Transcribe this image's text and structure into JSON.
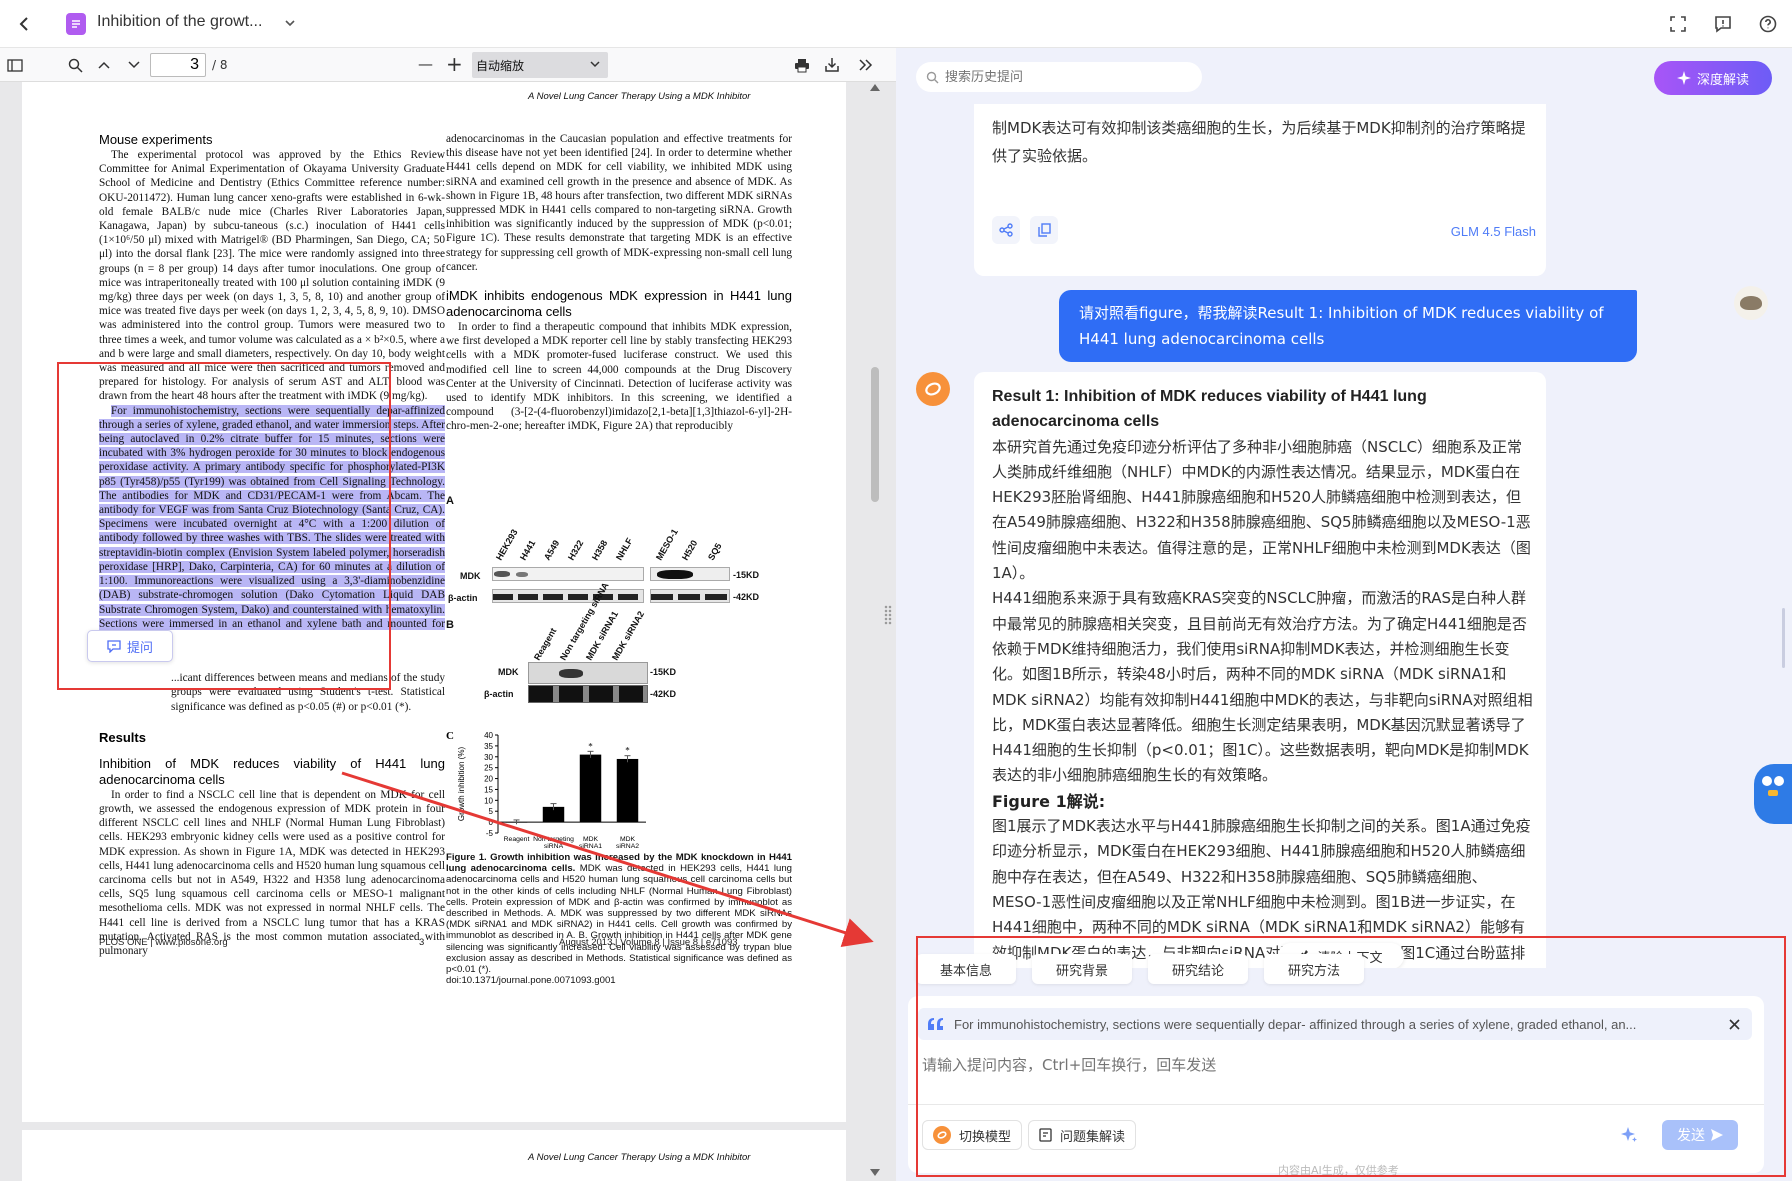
{
  "topbar": {
    "title": "Inhibition of the growt...",
    "back_icon": "chevron-left-icon",
    "doc_icon": "document-icon",
    "brand_color": "#8b5cf6"
  },
  "pdf_toolbar": {
    "page": "3",
    "page_total": "/ 8",
    "zoom": "自动缩放",
    "zoom_minus": "—",
    "zoom_plus": "+"
  },
  "pdf": {
    "running_header": "A Novel Lung Cancer Therapy Using a MDK Inhibitor",
    "footer_left": "PLOS ONE | www.plosone.org",
    "footer_center": "3",
    "footer_right": "August 2013 | Volume 8 | Issue 8 | e71093",
    "left": {
      "h_mouse": "Mouse experiments",
      "p_mouse": "The experimental protocol was approved by the Ethics Review Committee for Animal Experimentation of Okayama University Graduate School of Medicine and Dentistry (Ethics Committee reference number: OKU-2011472). Human lung cancer xeno-grafts were established in 6-wk-old female BALB/c nude mice (Charles River Laboratories Japan, Kanagawa, Japan) by subcu-taneous (s.c.) inoculation of H441 cells (1×10⁶/50 μl) mixed with Matrigel® (BD Pharmingen, San Diego, CA; 50 μl) into the dorsal flank [23]. The mice were randomly assigned into three groups (n = 8 per group) 14 days after tumor inoculations. One group of mice was intraperitoneally treated with 100 μl solution containing iMDK (9 mg/kg) three days per week (on days 1, 3, 5, 8, 10) and another group of mice was treated five days per week (on days 1, 2, 3, 4, 5, 8, 9, 10). DMSO was administered into the control group. Tumors were measured two to three times a week, and tumor volume was calculated as a × b²×0.5, where a and b were large and small diameters, respectively. On day 10, body weight was measured and all mice were then sacrificed and tumors removed and prepared for histology. For analysis of serum AST and ALT, blood was drawn from the heart 48 hours after the treatment with iMDK (9 mg/kg).",
      "p_ihc": "For immunohistochemistry, sections were sequentially depar-affinized through a series of xylene, graded ethanol, and water immersion steps. After being autoclaved in 0.2% citrate buffer for 15 minutes, sections were incubated with 3% hydrogen peroxide for 30 minutes to block endogenous peroxidase activity. A primary antibody specific for phosphorylated-PI3K p85 (Tyr458)/p55 (Tyr199) was obtained from Cell Signaling Technology. The antibodies for MDK and CD31/PECAM-1 were from Abcam. The antibody for VEGF was from Santa Cruz Biotechnology (Santa Cruz, CA). Specimens were incubated overnight at 4°C with a 1:200 dilution of antibody followed by three washes with TBS. The slides were treated with streptavidin-biotin complex (Envision System labeled polymer, horseradish peroxidase [HRP], Dako, Carpinteria, CA) for 60 minutes at a dilution of 1:100. Immunoreactions were visualized using a 3,3'-diaminobenzidine (DAB) substrate-chromogen solution (Dako Cytomation Liquid DAB Substrate Chromogen System, Dako) and counterstained with hematoxylin. Sections were immersed in an ethanol and xylene bath and mounted for examination.",
      "p_stat": "...icant differences between means and medians of the study groups were evaluated using Student's t-test. Statistical significance was defined as p<0.05 (#) or p<0.01 (*).",
      "h_results": "Results",
      "h_inhib": "Inhibition of MDK reduces viability of H441 lung adenocarcinoma cells",
      "p_inhib": "In order to find a NSCLC cell line that is dependent on MDK for cell growth, we assessed the endogenous expression of MDK protein in four different NSCLC cell lines and NHLF (Normal Human Lung Fibroblast) cells. HEK293 embryonic kidney cells were used as a positive control for MDK expression. As shown in Figure 1A, MDK was detected in HEK293 cells, H441 lung adenocarcinoma cells and H520 human lung squamous cell carcinoma cells but not in A549, H322 and H358 lung adenocarcinoma cells, SQ5 lung squamous cell carcinoma cells or MESO-1 malignant mesothelioma cells. MDK was not expressed in normal NHLF cells. The H441 cell line is derived from a NSCLC lung tumor that has a KRAS mutation. Activated RAS is the most common mutation associated with pulmonary"
    },
    "right": {
      "p_top": "adenocarcinomas in the Caucasian population and effective treatments for this disease have not yet been identified [24]. In order to determine whether H441 cells depend on MDK for cell viability, we inhibited MDK using siRNA and examined cell growth in the presence and absence of MDK. As shown in Figure 1B, 48 hours after transfection, two different MDK siRNAs suppressed MDK in H441 cells compared to non-targeting siRNA. Growth inhibition was significantly induced by the suppression of MDK (p<0.01; Figure 1C). These results demonstrate that targeting MDK is an effective strategy for suppressing cell growth of MDK-expressing non-small cell lung cancer.",
      "h_imdk": "iMDK inhibits endogenous MDK expression in H441 lung adenocarcinoma cells",
      "p_imdk": "In order to find a therapeutic compound that inhibits MDK expression, we first developed a MDK reporter cell line by stably transfecting HEK293 cells with a MDK promoter-fused luciferase construct. We used this modified cell line to screen 44,000 compounds at the Drug Discovery Center at the University of Cincinnati. Detection of luciferase activity was used to identify MDK inhibitors. In this screening, we identified a compound (3-[2-(4-fluorobenzyl)imidazo[2,1-beta][1,3]thiazol-6-yl]-2H-chro-men-2-one; hereafter iMDK, Figure 2A) that reproducibly",
      "caption_bold": "Figure 1. Growth inhibition was increased by the MDK knockdown in H441 lung adenocarcinoma cells.",
      "caption": " MDK was detected in HEK293 cells, H441 lung adenocarcinoma cells and H520 human lung squamous cell carcinoma cells but not in the other kinds of cells including NHLF (Normal Human Lung Fibroblast) cells. Protein expression of MDK and β-actin was confirmed by immunoblot as described in Methods. A. MDK was suppressed by two different MDK siRNAs (MDK siRNA1 and MDK siRNA2) in H441 cells. Cell growth was confirmed by immunoblot as described in A. B. Growth inhibition in H441 cells after MDK gene silencing was significantly increased. Cell viability was assessed by trypan blue exclusion assay as described in Methods. Statistical significance was defined as p<0.01 (*).",
      "doi": "doi:10.1371/journal.pone.0071093.g001"
    },
    "figA": {
      "label": "A",
      "lanes_left": [
        "HEK293",
        "H441",
        "A549",
        "H322",
        "H358",
        "NHLF"
      ],
      "lanes_right": [
        "MESO-1",
        "H520",
        "SQ5"
      ],
      "row1": "MDK",
      "row2": "β-actin",
      "kd1": "-15KD",
      "kd2": "-42KD"
    },
    "figB": {
      "label": "B",
      "lanes": [
        "Reagent",
        "Non targeting siRNA",
        "MDK siRNA1",
        "MDK siRNA2"
      ],
      "row1": "MDK",
      "row2": "β-actin",
      "kd1": "-15KD",
      "kd2": "-42KD"
    },
    "ask_button": "提问"
  },
  "chart_data": {
    "type": "bar",
    "label": "C",
    "categories": [
      "Reagent",
      "Non targeting siRNA",
      "MDK siRNA1",
      "MDK siRNA2"
    ],
    "values": [
      0,
      7,
      31,
      29
    ],
    "errors": [
      1,
      1.5,
      1.5,
      1.5
    ],
    "significance": [
      "",
      "",
      "*",
      "*"
    ],
    "ylabel": "Growth inhibition (%)",
    "ylim": [
      -5,
      40
    ],
    "yticks": [
      -5,
      0,
      5,
      10,
      15,
      20,
      25,
      30,
      35,
      40
    ]
  },
  "chat": {
    "search_placeholder": "搜索历史提问",
    "deep_button": "深度解读",
    "card1": {
      "text": "制MDK表达可有效抑制该类癌细胞的生长，为后续基于MDK抑制剂的治疗策略提供了实验依据。",
      "model": "GLM 4.5 Flash"
    },
    "user_msg": "请对照看figure，帮我解读Result 1: Inhibition of MDK reduces viability of H441 lung adenocarcinoma cells",
    "answer": {
      "title": "Result 1: Inhibition of MDK reduces viability of H441 lung adenocarcinoma cells",
      "p1": "本研究首先通过免疫印迹分析评估了多种非小细胞肺癌（NSCLC）细胞系及正常人类肺成纤维细胞（NHLF）中MDK的内源性表达情况。结果显示，MDK蛋白在HEK293胚胎肾细胞、H441肺腺癌细胞和H520人肺鳞癌细胞中检测到表达，但在A549肺腺癌细胞、H322和H358肺腺癌细胞、SQ5肺鳞癌细胞以及MESO-1恶性间皮瘤细胞中未表达。值得注意的是，正常NHLF细胞中未检测到MDK表达（图1A）。",
      "p2": "H441细胞系来源于具有致癌KRAS突变的NSCLC肿瘤，而激活的RAS是白种人群中最常见的肺腺癌相关突变，且目前尚无有效治疗方法。为了确定H441细胞是否依赖于MDK维持细胞活力，我们使用siRNA抑制MDK表达，并检测细胞生长变化。如图1B所示，转染48小时后，两种不同的MDK siRNA（MDK siRNA1和MDK siRNA2）均能有效抑制H441细胞中MDK的表达，与非靶向siRNA对照组相比，MDK蛋白表达显著降低。细胞生长测定结果表明，MDK基因沉默显著诱导了H441细胞的生长抑制（p<0.01；图1C）。这些数据表明，靶向MDK是抑制MDK表达的非小细胞肺癌细胞生长的有效策略。",
      "h2": "Figure 1解说:",
      "p3": "图1展示了MDK表达水平与H441肺腺癌细胞生长抑制之间的关系。图1A通过免疫印迹分析显示，MDK蛋白在HEK293细胞、H441肺腺癌细胞和H520人肺鳞癌细胞中存在表达，但在A549、H322和H358肺腺癌细胞、SQ5肺鳞癌细胞、MESO-1恶性间皮瘤细胞以及正常NHLF细胞中未检测到。图1B进一步证实，在H441细胞中，两种不同的MDK siRNA（MDK siRNA1和MDK siRNA2）能够有效抑制MDK蛋白的表达，与非靶向siRNA对照相比显著降低。图1C通过台盼蓝排斥法评估细胞活力，结"
    },
    "clear_context": "清除上下文",
    "tabs": [
      "基本信息",
      "研究背景",
      "研究结论",
      "研究方法"
    ],
    "quote": "For immunohistochemistry, sections were sequentially depar- affinized through a series of xylene, graded ethanol, an...",
    "input_placeholder": "请输入提问内容，Ctrl+回车换行，回车发送",
    "switch_model": "切换模型",
    "question_set": "问题集解读",
    "send": "发送",
    "disclaimer": "内容由AI生成，仅供参考",
    "accent": "#4f7cf7",
    "highlight_border": "#e53935"
  }
}
